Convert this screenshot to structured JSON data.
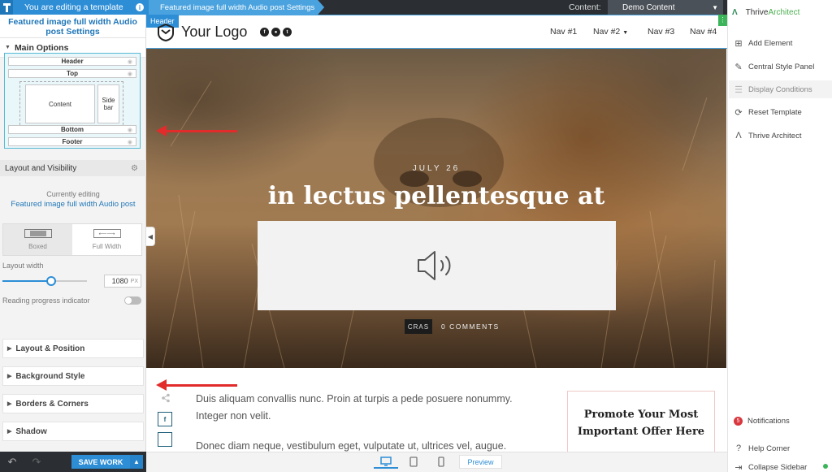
{
  "topbar": {
    "editing_notice": "You are editing a template",
    "breadcrumb": "Featured image full width Audio post Settings",
    "content_label": "Content:",
    "content_value": "Demo Content"
  },
  "left_panel": {
    "title": "Featured image full width Audio post Settings",
    "main_options": "Main Options",
    "structure": {
      "header": "Header",
      "top": "Top",
      "content": "Content",
      "sidebar": "Side bar",
      "bottom": "Bottom",
      "footer": "Footer"
    },
    "layout_visibility": "Layout and Visibility",
    "currently_editing": "Currently editing",
    "current_name": "Featured image full width Audio post",
    "boxed": "Boxed",
    "full_width": "Full Width",
    "layout_width_label": "Layout width",
    "layout_width_value": "1080",
    "layout_width_unit": "PX",
    "layout_width_fraction": 0.58,
    "reading_progress": "Reading progress indicator",
    "reading_progress_on": false,
    "sections": [
      "Layout & Position",
      "Background Style",
      "Borders & Corners",
      "Shadow"
    ],
    "save": "SAVE WORK"
  },
  "canvas": {
    "header_tag": "Header",
    "logo_text": "Your Logo",
    "social": [
      "f",
      "●",
      "t"
    ],
    "nav": [
      "Nav #1",
      "Nav #2",
      "Nav #3",
      "Nav #4"
    ],
    "hero_date": "JULY 26",
    "hero_title": "in lectus pellentesque at",
    "hero_tag": "CRAS",
    "hero_comments": "0 COMMENTS",
    "fb_letter": "f",
    "body_p1": "Duis aliquam convallis nunc. Proin at turpis a pede posuere nonummy. Integer non velit.",
    "body_p2": "Donec diam neque, vestibulum eget, vulputate ut, ultrices vel, augue.",
    "promo": "Promote Your Most Important Offer Here",
    "preview": "Preview"
  },
  "right_panel": {
    "brand_1": "Thrive",
    "brand_2": "Architect",
    "items": [
      "Add Element",
      "Central Style Panel",
      "Display Conditions",
      "Reset Template",
      "Thrive Architect"
    ],
    "notifications": "Notifications",
    "notifications_count": "5",
    "help": "Help Corner",
    "collapse": "Collapse Sidebar"
  },
  "colors": {
    "accent": "#2d8ed6",
    "topbar": "#2b2f33",
    "arrow": "#e22b2b",
    "thrive_green": "#4caf50"
  }
}
